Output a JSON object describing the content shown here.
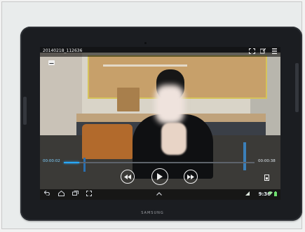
{
  "player": {
    "video_title": "20140218_112636",
    "time_elapsed": "00:00:02",
    "time_total": "00:00:38",
    "progress": 0.08
  },
  "system": {
    "clock": "9:36"
  },
  "device": {
    "brand": "SAMSUNG"
  },
  "icons": {
    "title_bar": [
      "screen-fit-icon",
      "share-icon",
      "menu-icon"
    ],
    "subtitle": "subtitle-icon",
    "controls": [
      "rewind-icon",
      "play-icon",
      "fast-forward-icon"
    ],
    "extra": "popup-player-icon",
    "nav": [
      "back-icon",
      "home-icon",
      "recent-apps-icon",
      "screenshot-icon",
      "up-chevron-icon"
    ],
    "status": [
      "signal-icon",
      "wifi-icon",
      "battery-icon"
    ]
  },
  "colors": {
    "accent": "#29a9ff",
    "tablet_body": "#1b1d21"
  }
}
